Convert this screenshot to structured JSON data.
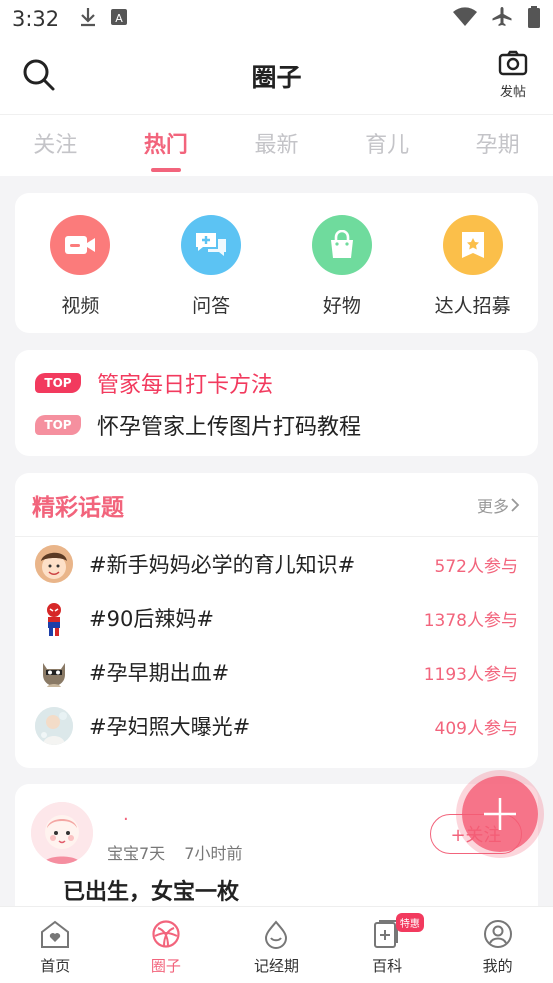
{
  "status_bar": {
    "time": "3:32"
  },
  "header": {
    "title": "圈子",
    "post_label": "发帖"
  },
  "tabs": [
    {
      "label": "关注"
    },
    {
      "label": "热门"
    },
    {
      "label": "最新"
    },
    {
      "label": "育儿"
    },
    {
      "label": "孕期"
    }
  ],
  "quick_entries": [
    {
      "label": "视频",
      "color": "#fb7b7b",
      "icon": "video-icon"
    },
    {
      "label": "问答",
      "color": "#5cc3f3",
      "icon": "chat-bubbles-icon"
    },
    {
      "label": "好物",
      "color": "#6fdb9d",
      "icon": "shopping-bag-icon"
    },
    {
      "label": "达人招募",
      "color": "#fbbf4a",
      "icon": "star-badge-icon"
    }
  ],
  "top_posts": [
    {
      "badge": "TOP",
      "title": "管家每日打卡方法",
      "badge_color": "#f23a5e",
      "title_color": "#f23a5e"
    },
    {
      "badge": "TOP",
      "title": "怀孕管家上传图片打码教程",
      "badge_color": "#f5909f",
      "title_color": "#222222"
    }
  ],
  "topics": {
    "title": "精彩话题",
    "more_label": "更多",
    "items": [
      {
        "name": "#新手妈妈必学的育儿知识#",
        "count": "572人参与"
      },
      {
        "name": "#90后辣妈#",
        "count": "1378人参与"
      },
      {
        "name": "#孕早期出血#",
        "count": "1193人参与"
      },
      {
        "name": "#孕妇照大曝光#",
        "count": "409人参与"
      }
    ]
  },
  "post": {
    "username": ".",
    "baby_age": "宝宝7天",
    "time_ago": "7小时前",
    "follow_label": "+关注",
    "title": "已出生，女宝一枚"
  },
  "bottom_nav": [
    {
      "label": "首页",
      "icon": "home-heart-icon"
    },
    {
      "label": "圈子",
      "icon": "circle-icon"
    },
    {
      "label": "记经期",
      "icon": "drop-icon"
    },
    {
      "label": "百科",
      "icon": "book-plus-icon",
      "badge": "特惠"
    },
    {
      "label": "我的",
      "icon": "profile-icon"
    }
  ],
  "colors": {
    "accent": "#f2647c",
    "background": "#f4f4f6"
  }
}
